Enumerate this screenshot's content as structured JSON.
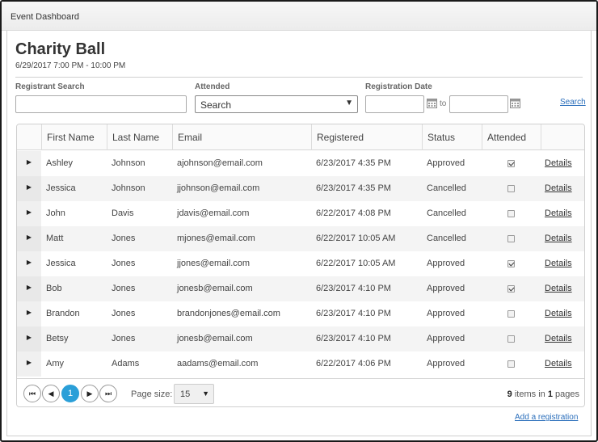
{
  "window": {
    "title": "Event Dashboard"
  },
  "event": {
    "name": "Charity Ball",
    "date": "6/29/2017 7:00 PM - 10:00 PM"
  },
  "filters": {
    "registrant_search_label": "Registrant Search",
    "registrant_search_value": "",
    "attended_label": "Attended",
    "attended_selected": "Search",
    "registration_date_label": "Registration Date",
    "date_from_value": "",
    "date_to_value": "",
    "to_label": "to",
    "search_link": "Search"
  },
  "grid": {
    "columns": [
      "First Name",
      "Last Name",
      "Email",
      "Registered",
      "Status",
      "Attended"
    ],
    "details_label": "Details",
    "rows": [
      {
        "first": "Ashley",
        "last": "Johnson",
        "email": "ajohnson@email.com",
        "registered": "6/23/2017 4:35 PM",
        "status": "Approved",
        "attended": true
      },
      {
        "first": "Jessica",
        "last": "Johnson",
        "email": "jjohnson@email.com",
        "registered": "6/23/2017 4:35 PM",
        "status": "Cancelled",
        "attended": false
      },
      {
        "first": "John",
        "last": "Davis",
        "email": "jdavis@email.com",
        "registered": "6/22/2017 4:08 PM",
        "status": "Cancelled",
        "attended": false
      },
      {
        "first": "Matt",
        "last": "Jones",
        "email": "mjones@email.com",
        "registered": "6/22/2017 10:05 AM",
        "status": "Cancelled",
        "attended": false
      },
      {
        "first": "Jessica",
        "last": "Jones",
        "email": "jjones@email.com",
        "registered": "6/22/2017 10:05 AM",
        "status": "Approved",
        "attended": true
      },
      {
        "first": "Bob",
        "last": "Jones",
        "email": "jonesb@email.com",
        "registered": "6/23/2017 4:10 PM",
        "status": "Approved",
        "attended": true
      },
      {
        "first": "Brandon",
        "last": "Jones",
        "email": "brandonjones@email.com",
        "registered": "6/23/2017 4:10 PM",
        "status": "Approved",
        "attended": false
      },
      {
        "first": "Betsy",
        "last": "Jones",
        "email": "jonesb@email.com",
        "registered": "6/23/2017 4:10 PM",
        "status": "Approved",
        "attended": false
      },
      {
        "first": "Amy",
        "last": "Adams",
        "email": "aadams@email.com",
        "registered": "6/22/2017 4:06 PM",
        "status": "Approved",
        "attended": false
      }
    ]
  },
  "pager": {
    "first_icon": "first-page-icon",
    "prev_icon": "prev-page-icon",
    "next_icon": "next-page-icon",
    "last_icon": "last-page-icon",
    "current_page": "1",
    "page_size_label": "Page size:",
    "page_size_value": "15",
    "items_count": "9",
    "items_text": "items in",
    "pages_count": "1",
    "pages_text": "pages"
  },
  "add_registration_link": "Add a registration",
  "colors": {
    "accent": "#2a9fd8",
    "link": "#2a6ebb"
  }
}
